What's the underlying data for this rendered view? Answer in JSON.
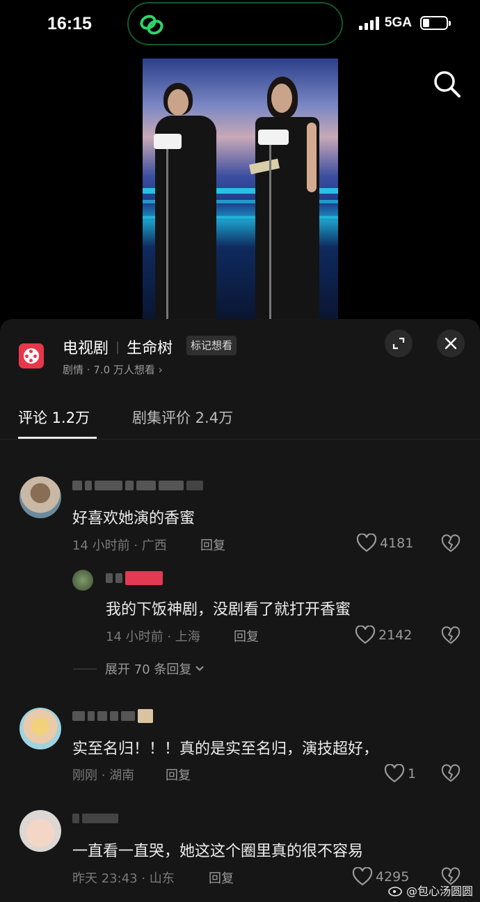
{
  "status_bar": {
    "time": "16:15",
    "network": "5GA"
  },
  "sheet": {
    "show_category": "电视剧",
    "show_name": "生命树",
    "mark_button": "标记想看",
    "show_subtitle": "剧情 · 7.0 万人想看 ›",
    "tabs": [
      {
        "label": "评论 1.2万"
      },
      {
        "label": "剧集评价 2.4万"
      }
    ]
  },
  "comments": [
    {
      "text": "好喜欢她演的香蜜",
      "time_location": "14 小时前 · 广西",
      "reply_label": "回复",
      "likes": "4181",
      "replies": [
        {
          "text": "我的下饭神剧，没剧看了就打开香蜜",
          "time_location": "14 小时前 · 上海",
          "reply_label": "回复",
          "likes": "2142"
        }
      ],
      "expand_label": "展开 70 条回复"
    },
    {
      "text": "实至名归！！！真的是实至名归，演技超好，",
      "time_location": "刚刚 · 湖南",
      "reply_label": "回复",
      "likes": "1"
    },
    {
      "text": "一直看一直哭，她这这个圈里真的很不容易",
      "time_location": "昨天 23:43 · 山东",
      "reply_label": "回复",
      "likes": "4295"
    }
  ],
  "watermark": "@包心汤圆圆",
  "colors": {
    "brand_icon": "#e8374a",
    "island_border": "#0f5a2a",
    "sheet_bg": "#161616"
  },
  "icons": [
    "search-icon",
    "expand-icon",
    "close-icon",
    "heart-icon",
    "broken-heart-icon",
    "chevron-down-icon"
  ]
}
